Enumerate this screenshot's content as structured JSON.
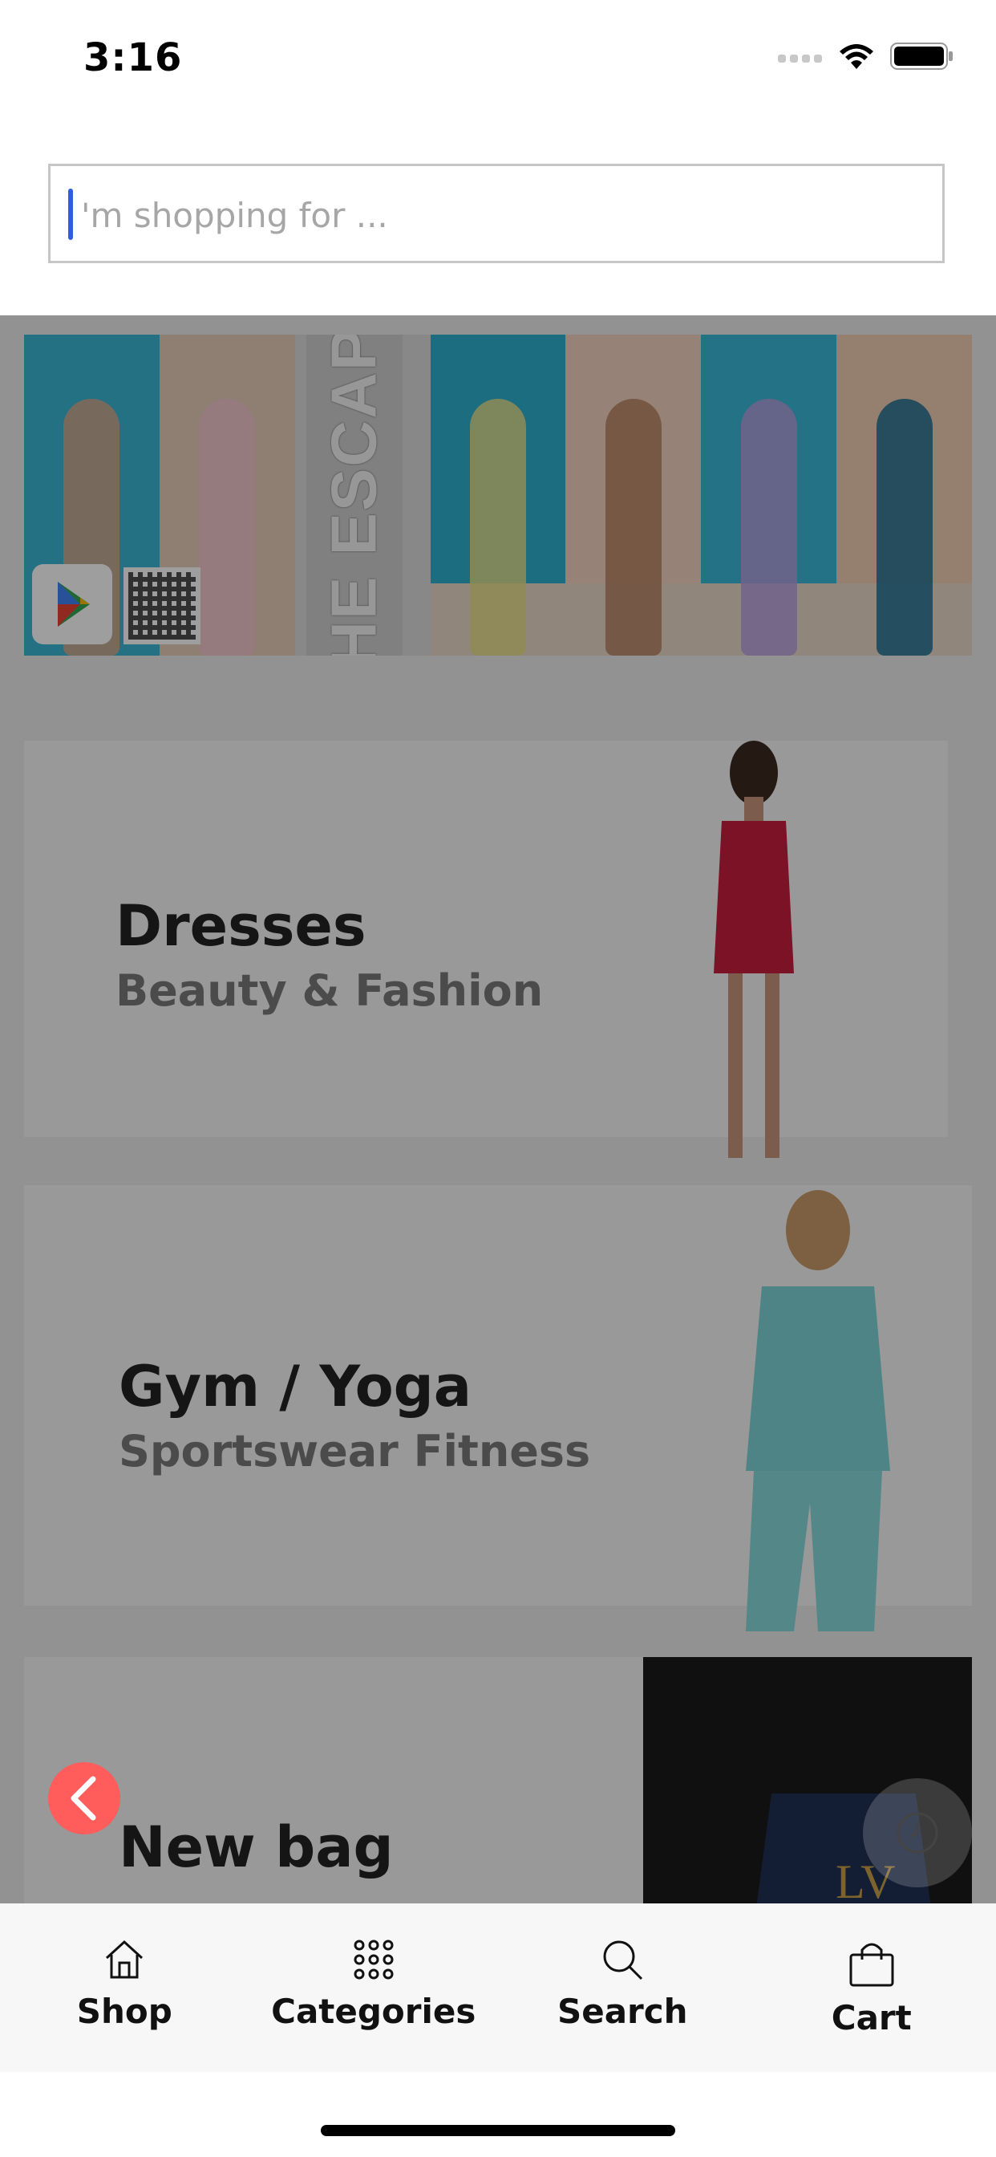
{
  "status_bar": {
    "time": "3:16"
  },
  "search": {
    "placeholder": "'m shopping for ..."
  },
  "banner": {
    "title": "THE ESCAPE",
    "store_badge": "Google Play"
  },
  "categories": [
    {
      "title": "Dresses",
      "subtitle": "Beauty & Fashion",
      "image_color": "#c81e3c"
    },
    {
      "title": "Gym / Yoga",
      "subtitle": "Sportswear Fitness",
      "image_color": "#7fd6d8"
    },
    {
      "title": "New bag",
      "subtitle": "",
      "image_color": "#1a1a1a"
    }
  ],
  "tab_bar": {
    "items": [
      {
        "label": "Shop",
        "icon": "home-icon"
      },
      {
        "label": "Categories",
        "icon": "grid-icon"
      },
      {
        "label": "Search",
        "icon": "search-icon"
      },
      {
        "label": "Cart",
        "icon": "bag-icon"
      }
    ]
  },
  "colors": {
    "accent": "#ff5c5c",
    "caret": "#2f5ce0"
  }
}
